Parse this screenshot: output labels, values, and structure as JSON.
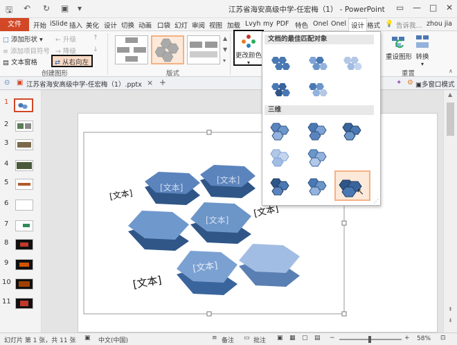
{
  "window": {
    "title": "江苏省海安高级中学-任宏梅（1） - PowerPoint"
  },
  "tabs": {
    "file": "文件",
    "items": [
      "开始",
      "iSlide",
      "插入",
      "美化",
      "设计",
      "切换",
      "动画",
      "口袋",
      "幻灯",
      "审阅",
      "视图",
      "加载",
      "Lvyh",
      "my",
      "PDF",
      "特色",
      "Onel",
      "Onel",
      "设计",
      "格式"
    ],
    "active": "设计",
    "search": "告诉我...",
    "user": "zhou jia"
  },
  "ribbon": {
    "add_shape": "添加形状",
    "add_bullet": "添加项目符号",
    "text_pane": "文本窗格",
    "promote": "升级",
    "demote": "降级",
    "right_to_left": "从右向左",
    "group_create": "创建图形",
    "group_layout": "版式",
    "change_colors": "更改颜色",
    "reset_graphic": "重设图形",
    "convert": "转换",
    "group_reset": "重置"
  },
  "color_panel": {
    "section1": "文档的最佳匹配对象",
    "section2": "三维"
  },
  "doc_tab": {
    "name": "江苏省海安高级中学-任宏梅（1）.pptx",
    "close": "×",
    "add": "+",
    "multi_window": "多窗口模式"
  },
  "slides": {
    "numbers": [
      "1",
      "2",
      "3",
      "4",
      "5",
      "6",
      "7",
      "8",
      "9",
      "10",
      "11"
    ],
    "selected": "1"
  },
  "slide": {
    "labels": [
      "[文本]",
      "[文本]",
      "[文本]",
      "[文本]",
      "[文本]",
      "[文本]"
    ]
  },
  "status": {
    "slide_info": "幻灯片 第 1 张，共 11 张",
    "language": "中文(中国)",
    "notes": "备注",
    "comments": "批注",
    "zoom": "58%"
  },
  "colors": {
    "file_tab": "#d24726",
    "hex_dark": "#4a78b3",
    "hex_mid": "#6c95c8",
    "hex_light": "#93b2dc",
    "highlight": "#f4b183"
  }
}
